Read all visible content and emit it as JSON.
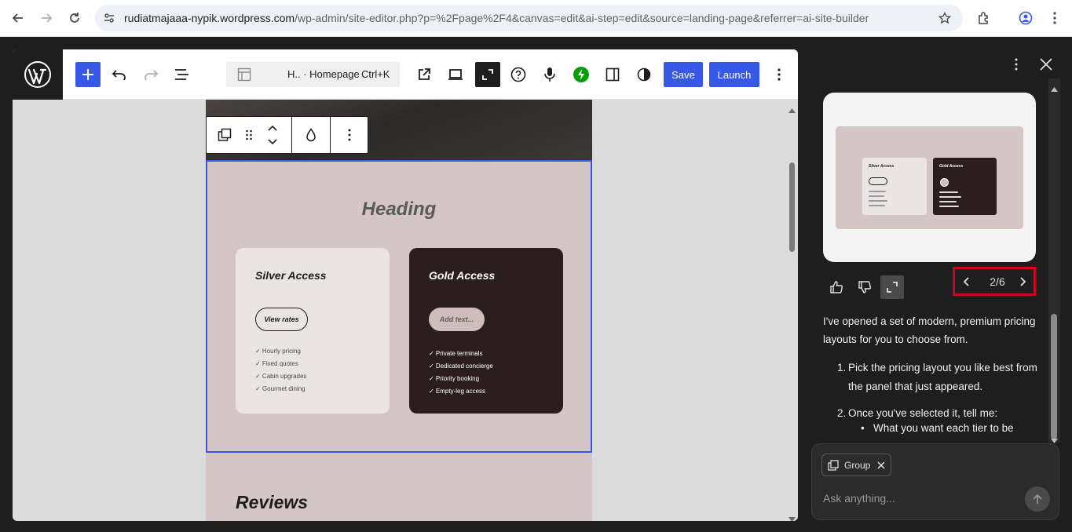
{
  "browser": {
    "url_host": "rudiatmajaaa-nypik.wordpress.com",
    "url_path": "/wp-admin/site-editor.php?p=%2Fpage%2F4&canvas=edit&ai-step=edit&source=landing-page&referrer=ai-site-builder"
  },
  "editor": {
    "doc_title": "H.. · Homepage",
    "doc_shortcut": "Ctrl+K",
    "save_label": "Save",
    "launch_label": "Launch"
  },
  "canvas": {
    "heading": "Heading",
    "reviews": "Reviews",
    "silver": {
      "title": "Silver Access",
      "button": "View rates",
      "features": [
        "✓ Hourly pricing",
        "✓ Fixed quotes",
        "✓ Cabin upgrades",
        "✓ Gourmet dining"
      ]
    },
    "gold": {
      "title": "Gold Access",
      "button": "Add text...",
      "features": [
        "✓ Private terminals",
        "✓ Dedicated concierge",
        "✓ Priority booking",
        "✓ Empty-leg access"
      ]
    }
  },
  "panel": {
    "preview": {
      "silver_title": "Silver Access",
      "gold_title": "Gold Access"
    },
    "pager_text": "2/6",
    "message_intro": "I've opened a set of modern, premium pricing layouts for you to choose from.",
    "steps": [
      {
        "num": "1.",
        "text": "Pick the pricing layout you like best from the panel that just appeared."
      },
      {
        "num": "2.",
        "text": "Once you've selected it, tell me:"
      }
    ],
    "bullet": "What you want each tier to be",
    "chip_label": "Group",
    "input_placeholder": "Ask anything..."
  },
  "colors": {
    "accent": "#3858e9",
    "highlight": "#d0021b",
    "canvas_bg": "#d4c5c6",
    "gold_card": "#2a1e1f",
    "silver_card": "#ebe4e4"
  }
}
